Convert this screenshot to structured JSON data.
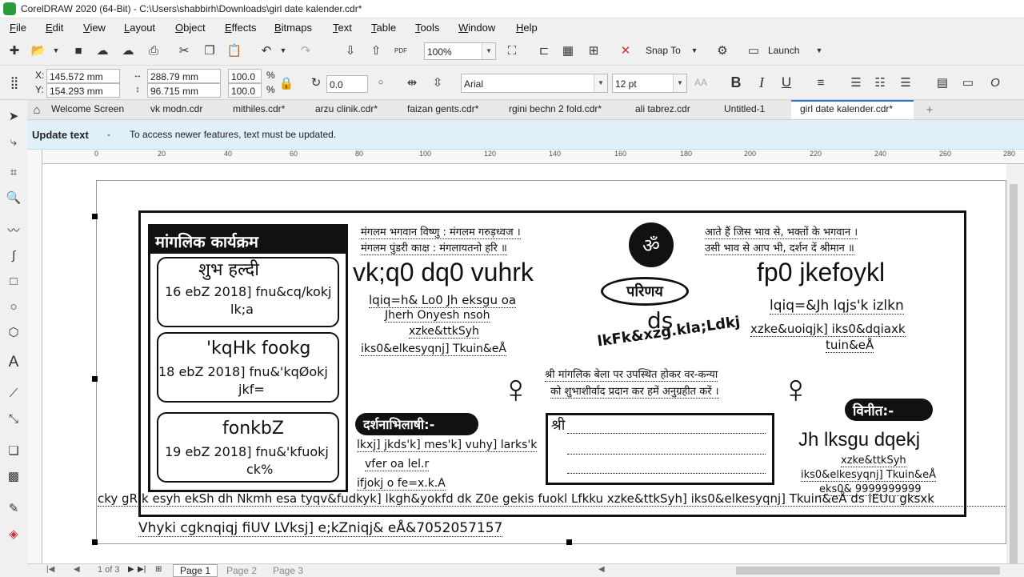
{
  "window": {
    "title": "CorelDRAW 2020 (64-Bit) - C:\\Users\\shabbirh\\Downloads\\girl date kalender.cdr*"
  },
  "menu": [
    "File",
    "Edit",
    "View",
    "Layout",
    "Object",
    "Effects",
    "Bitmaps",
    "Text",
    "Table",
    "Tools",
    "Window",
    "Help"
  ],
  "toolbar": {
    "zoom": "100%",
    "snap_to": "Snap To",
    "launch": "Launch"
  },
  "property_bar": {
    "x_label": "X:",
    "x_value": "145.572 mm",
    "y_label": "Y:",
    "y_value": "154.293 mm",
    "width_value": "288.79 mm",
    "height_value": "96.715 mm",
    "scale_w": "100.0",
    "scale_h": "100.0",
    "percent": "%",
    "rotation": "0.0",
    "font_name": "Arial",
    "font_size": "12 pt"
  },
  "tabs": [
    "Welcome Screen",
    "vk modn.cdr",
    "mithiles.cdr*",
    "arzu clinik.cdr*",
    "faizan gents.cdr*",
    "rgini bechn 2 fold.cdr*",
    "ali tabrez.cdr",
    "Untitled-1",
    "girl date kalender.cdr*"
  ],
  "active_tab_index": 8,
  "update_banner": {
    "title": "Update text",
    "dash": "-",
    "message": "To access newer features, text must be updated."
  },
  "ruler": {
    "h_ticks": [
      "0",
      "20",
      "40",
      "60",
      "80",
      "100",
      "120",
      "140",
      "160",
      "180",
      "200",
      "220",
      "240",
      "260",
      "280"
    ]
  },
  "card": {
    "left_header": "मांगलिक कार्यक्रम",
    "haldi_title": "शुभ हल्दी",
    "haldi_date": "16 ebZ 2018] fnu&cq/kokj",
    "haldi_time": "lk;a",
    "block2_title": "'kqHk fookg",
    "block2_date": "18 ebZ 2018] fnu&'kqØokj",
    "block2_time": "jkf=",
    "block3_title": "fonkbZ",
    "block3_date": "19 ebZ 2018] fnu&'kfuokj",
    "block3_time": "ck%",
    "top_verse_1": "मंगलम भगवान विष्णु : मंगलम गरुड़ध्वज ।",
    "top_verse_2": "मंगलम पुंडरी काक्ष : मंगलायतनो हरि ॥",
    "bride_name": "vk;q0 dq0 vuhrk",
    "bride_detail": "lqiq=h& Lo0 Jh eksgu oa",
    "bride_mother": "Jherh Onyesh nsoh",
    "bride_village": "xzke&ttkSyh",
    "bride_post": "iks0&elkesyqnj] Tkuin&eÅ",
    "parinay": "परिणय",
    "ds": "ds",
    "shubh": "lkFk&xzg.kla;Ldkj",
    "groom_name": "fp0 jkefoykl",
    "groom_detail": "lqiq=&Jh lqjs'k izlkn",
    "groom_village": "xzke&uoiqjk] iks0&dqiaxk",
    "groom_district": "tuin&eÅ",
    "right_verse_1": "आते हैं जिस भाव से, भक्तों के भगवान ।",
    "right_verse_2": "उसी भाव से आप भी, दर्शन दें श्रीमान ॥",
    "mid_verse_1": "श्री मांगलिक बेला पर उपस्थित होकर वर-कन्या",
    "mid_verse_2": "को शुभाशीर्वाद प्रदान कर हमें अनुग्रहीत करें ।",
    "darshan_label": "दर्शनाभिलाषी:-",
    "darshan_1": "lkxj] jkds'k] mes'k] vuhy] larks'k",
    "darshan_2": "vfer oa lel.r",
    "darshan_3": "ifjokj o  fe=x.k.A",
    "shri": "श्री",
    "vinit_label": "विनीत:-",
    "vinit_name": "Jh lksgu dqekj",
    "vinit_village": "xzke&ttkSyh",
    "vinit_post": "iks0&elkesyqnj] Tkuin&eÅ",
    "vinit_phone": "eks0& 9999999999",
    "bottom_line": "cky gR;k esyh ekSh dh Nkmh esa tyqv&fudkyk] lkgh&yokfd dk Z0e gekis fuokl Lfkku xzke&ttkSyh] iks0&elkesyqnj] Tkuin&eÅ ds lEUu gksxk",
    "footer_line": "Vhyki cgknqiqj fiUV LVksj] e;kZniqj& eÅ&7052057157"
  },
  "pages": {
    "nav": "1 of 3",
    "page1": "Page 1",
    "page2": "Page 2",
    "page3": "Page 3"
  }
}
